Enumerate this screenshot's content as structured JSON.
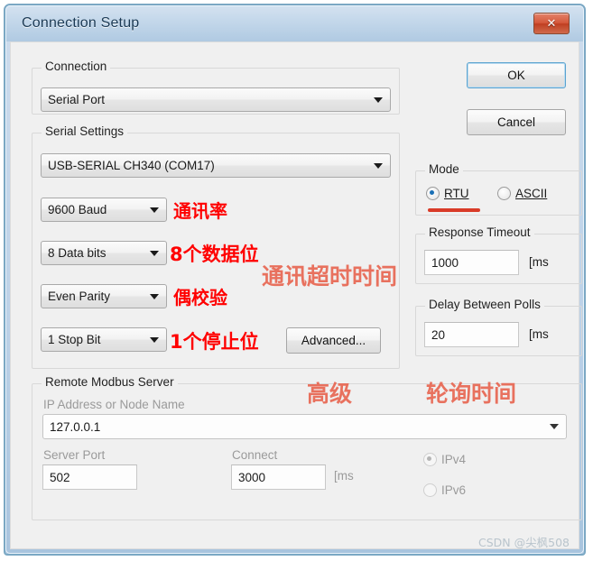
{
  "window": {
    "title": "Connection Setup",
    "close_label": "✕"
  },
  "buttons": {
    "ok": "OK",
    "cancel": "Cancel",
    "advanced": "Advanced..."
  },
  "connection": {
    "group_title": "Connection",
    "selected": "Serial Port"
  },
  "serial_settings": {
    "group_title": "Serial Settings",
    "port": "USB-SERIAL CH340 (COM17)",
    "baud": "9600 Baud",
    "data_bits": "8 Data bits",
    "parity": "Even Parity",
    "stop_bits": "1 Stop Bit"
  },
  "mode": {
    "group_title": "Mode",
    "rtu": "RTU",
    "ascii": "ASCII",
    "selected": "RTU"
  },
  "response_timeout": {
    "group_title": "Response Timeout",
    "value": "1000",
    "unit": "[ms"
  },
  "delay_between_polls": {
    "group_title": "Delay Between Polls",
    "value": "20",
    "unit": "[ms"
  },
  "remote_server": {
    "group_title": "Remote Modbus Server",
    "ip_label": "IP Address or Node Name",
    "ip_value": "127.0.0.1",
    "server_port_label": "Server Port",
    "server_port_value": "502",
    "connect_label": "Connect",
    "connect_value": "3000",
    "connect_unit": "[ms",
    "ipv4": "IPv4",
    "ipv6": "IPv6",
    "ip_version_selected": "IPv4"
  },
  "annotations": {
    "baud": "通讯率",
    "data_bits": "8个数据位",
    "parity": "偶校验",
    "stop_bits": "1个停止位",
    "timeout": "通讯超时时间",
    "advanced": "高级",
    "poll_interval": "轮询时间"
  },
  "watermark": "CSDN @尖枫508",
  "colors": {
    "accent": "#1a6fb5",
    "annotation": "#ff0000",
    "title_bar": "#b0cae2",
    "close_button": "#d4573a"
  }
}
